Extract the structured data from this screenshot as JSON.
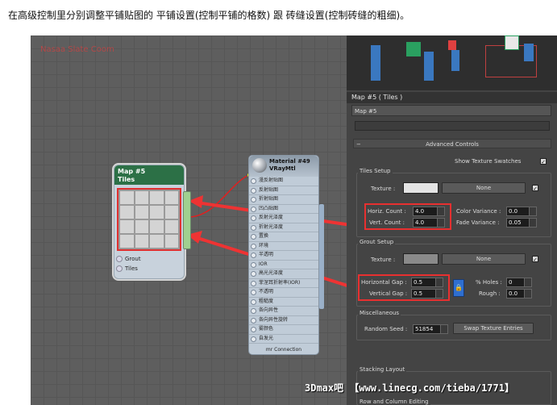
{
  "caption": "在高级控制里分别调整平铺贴图的 平铺设置(控制平铺的格数) 跟 砖缝设置(控制砖缝的粗细)。",
  "slate": {
    "view_title": "Nasaa Slate Coom"
  },
  "tiles_node": {
    "title_line1": "Map #5",
    "title_line2": "Tiles",
    "port_grout": "Grout",
    "port_tiles": "Tiles"
  },
  "material_node": {
    "title_line1": "Material #49",
    "title_line2": "VRayMtl",
    "slots": [
      "漫反射贴图",
      "反射贴图",
      "折射贴图",
      "凹凸贴图",
      "反射光泽度",
      "折射光泽度",
      "置换",
      "环境",
      "半透明",
      "IOR",
      "高光光泽度",
      "菲涅耳折射率(IOR)",
      "不透明",
      "粗糙度",
      "各向异性",
      "各向异性旋转",
      "雾颜色",
      "自发光"
    ],
    "footer": "mr Connection"
  },
  "panel": {
    "map_title": "Map #5  ( Tiles )",
    "map_name": "Map #5",
    "advanced_controls": "Advanced Controls",
    "show_texture_swatches": "Show Texture Swatches",
    "tiles_setup": {
      "title": "Tiles Setup",
      "texture_label": "Texture :",
      "texture_button": "None",
      "horiz_count_label": "Horiz. Count :",
      "horiz_count": "4.0",
      "vert_count_label": "Vert. Count :",
      "vert_count": "4.0",
      "color_variance_label": "Color Variance :",
      "color_variance": "0.0",
      "fade_variance_label": "Fade Variance :",
      "fade_variance": "0.05"
    },
    "grout_setup": {
      "title": "Grout Setup",
      "texture_label": "Texture :",
      "texture_button": "None",
      "horizontal_gap_label": "Horizontal Gap :",
      "horizontal_gap": "0.5",
      "vertical_gap_label": "Vertical Gap :",
      "vertical_gap": "0.5",
      "holes_label": "% Holes :",
      "holes": "0",
      "rough_label": "Rough :",
      "rough": "0.0"
    },
    "miscellaneous": {
      "title": "Miscellaneous",
      "random_seed_label": "Random Seed :",
      "random_seed": "51854",
      "swap_button": "Swap Texture Entries"
    },
    "stacking_layout": "Stacking Layout",
    "row_column_editing": "Row and Column Editing"
  },
  "watermark": "3Dmax吧 【www.linecg.com/tieba/1771】",
  "colors": {
    "highlight_red": "#e83030",
    "node_header_green": "#2c7046",
    "lock_blue": "#2f6fd0"
  }
}
